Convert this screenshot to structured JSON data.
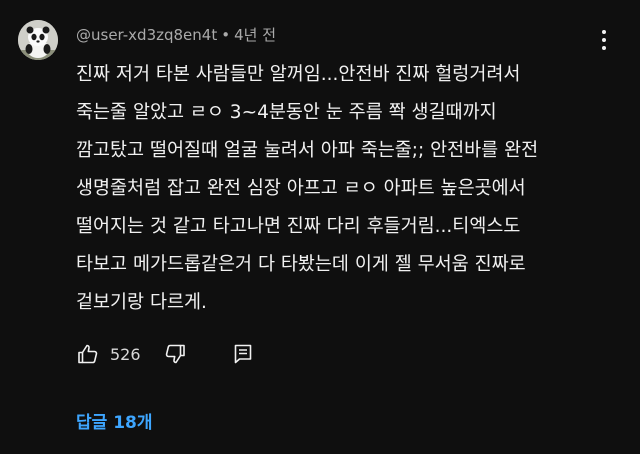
{
  "comment": {
    "author": "@user-xd3zq8en4t",
    "separator": "•",
    "time": "4년 전",
    "lines": [
      "진짜 저거 타본 사람들만 알꺼임...안전바 진짜 헐렁거려서",
      "죽는줄 알았고 ㄹㅇ 3~4분동안 눈 주름 쫙 생길때까지",
      "깜고탔고 떨어질때 얼굴 눌려서 아파 죽는줄;; 안전바를 완전",
      "생명줄처럼 잡고 완전 심장 아프고 ㄹㅇ 아파트 높은곳에서",
      "떨어지는 것 같고 타고나면 진짜 다리 후들거림...티엑스도",
      "타보고 메가드롭같은거 다 타봤는데 이게 젤 무서움 진짜로",
      "겉보기랑 다르게."
    ]
  },
  "actions": {
    "like_count": "526"
  },
  "replies": {
    "label": "답글 18개"
  },
  "icons": {
    "avatar": "panda-avatar",
    "menu": "more-vertical-icon",
    "like": "thumbs-up-icon",
    "dislike": "thumbs-down-icon",
    "reply": "reply-icon"
  },
  "colors": {
    "background": "#0f0f0f",
    "text": "#f1f1f1",
    "meta": "#aaaaaa",
    "link": "#3ea6ff"
  }
}
